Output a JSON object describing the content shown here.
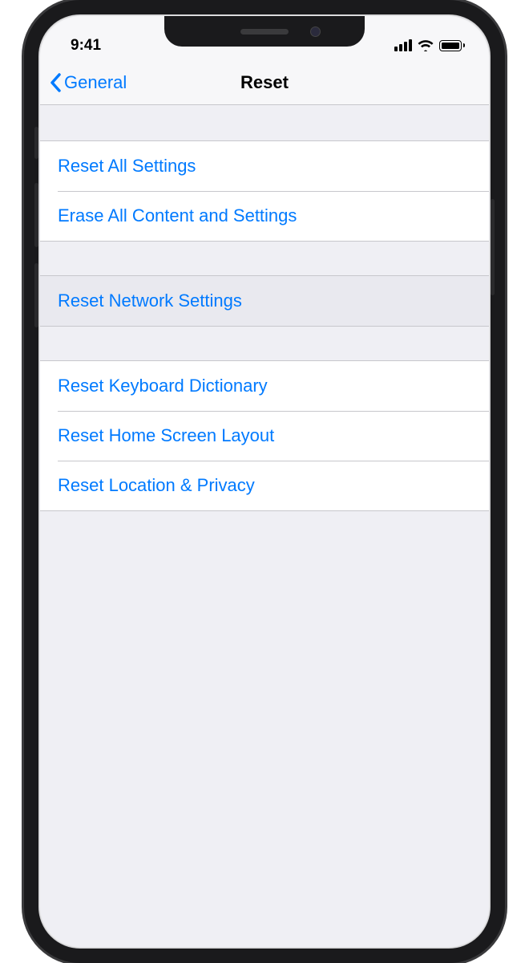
{
  "status": {
    "time": "9:41"
  },
  "nav": {
    "back_label": "General",
    "title": "Reset"
  },
  "groups": [
    {
      "items": [
        {
          "label": "Reset All Settings",
          "selected": false
        },
        {
          "label": "Erase All Content and Settings",
          "selected": false
        }
      ]
    },
    {
      "items": [
        {
          "label": "Reset Network Settings",
          "selected": true
        }
      ]
    },
    {
      "items": [
        {
          "label": "Reset Keyboard Dictionary",
          "selected": false
        },
        {
          "label": "Reset Home Screen Layout",
          "selected": false
        },
        {
          "label": "Reset Location & Privacy",
          "selected": false
        }
      ]
    }
  ]
}
